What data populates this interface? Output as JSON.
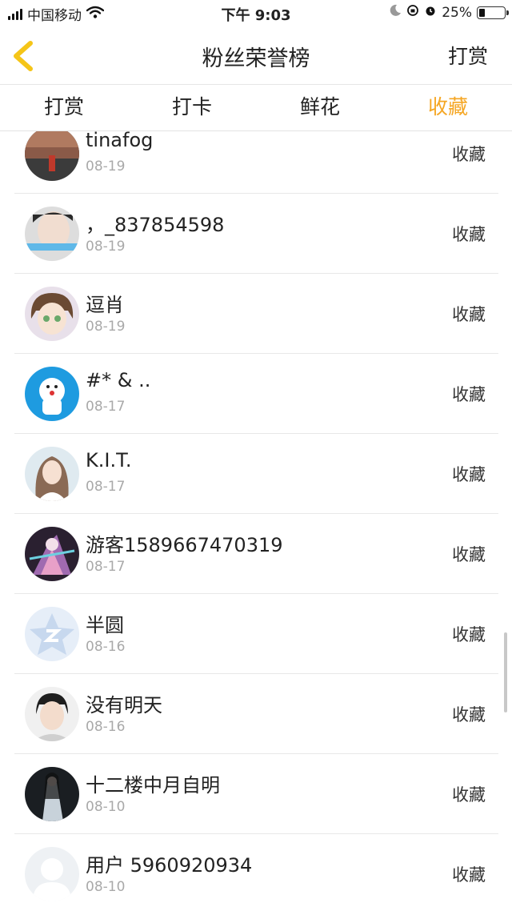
{
  "status_bar": {
    "carrier": "中国移动",
    "time": "下午 9:03",
    "battery": "25%",
    "battery_level": 0.25
  },
  "nav": {
    "title": "粉丝荣誉榜",
    "action": "打赏"
  },
  "tabs": [
    {
      "label": "打赏",
      "active": false
    },
    {
      "label": "打卡",
      "active": false
    },
    {
      "label": "鲜花",
      "active": false
    },
    {
      "label": "收藏",
      "active": true
    }
  ],
  "colors": {
    "accent": "#f5a623",
    "back_arrow": "#f5c518"
  },
  "list": [
    {
      "name": "tinafog",
      "date": "08-19",
      "action": "收藏",
      "avatar": "photo-avatar"
    },
    {
      "name": "，_837854598",
      "date": "08-19",
      "action": "收藏",
      "avatar": "face-avatar"
    },
    {
      "name": "逗肖",
      "date": "08-19",
      "action": "收藏",
      "avatar": "anime-girl-avatar"
    },
    {
      "name": "#* & ..",
      "date": "08-17",
      "action": "收藏",
      "avatar": "doraemon-avatar"
    },
    {
      "name": "K.I.T.",
      "date": "08-17",
      "action": "收藏",
      "avatar": "girl-photo-avatar"
    },
    {
      "name": "游客1589667470319",
      "date": "08-17",
      "action": "收藏",
      "avatar": "anime-avatar"
    },
    {
      "name": "半圆",
      "date": "08-16",
      "action": "收藏",
      "avatar": "qzone-star-avatar"
    },
    {
      "name": "没有明天",
      "date": "08-16",
      "action": "收藏",
      "avatar": "boy-photo-avatar"
    },
    {
      "name": "十二楼中月自明",
      "date": "08-10",
      "action": "收藏",
      "avatar": "dark-figure-avatar"
    },
    {
      "name": "用户 5960920934",
      "date": "08-10",
      "action": "收藏",
      "avatar": "default-avatar"
    }
  ]
}
